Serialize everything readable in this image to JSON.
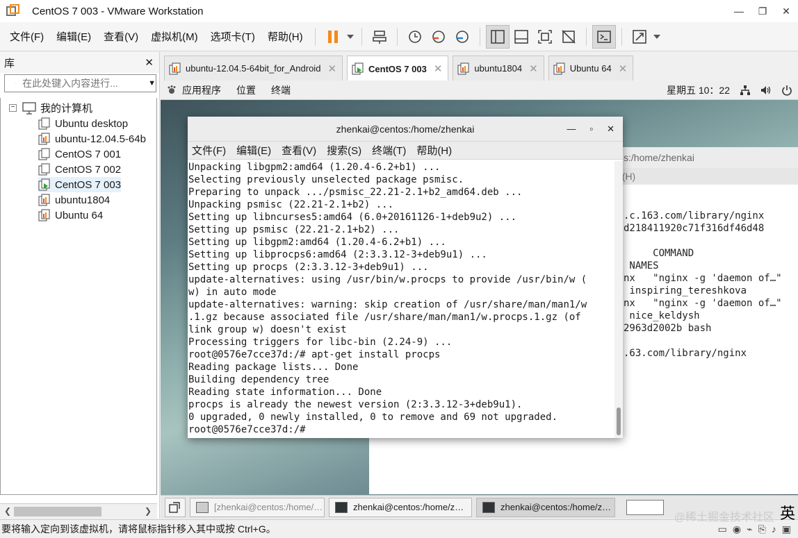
{
  "window": {
    "title": "CentOS 7 003 - VMware Workstation",
    "min": "—",
    "max": "❐",
    "close": "✕"
  },
  "menu": [
    "文件(F)",
    "编辑(E)",
    "查看(V)",
    "虚拟机(M)",
    "选项卡(T)",
    "帮助(H)"
  ],
  "library": {
    "header": "库",
    "close": "✕",
    "search_placeholder": "在此处键入内容进行...",
    "root": "我的计算机",
    "items": [
      "Ubuntu desktop",
      "ubuntu-12.04.5-64b",
      "CentOS 7 001",
      "CentOS 7 002",
      "CentOS 7 003",
      "ubuntu1804",
      "Ubuntu 64"
    ],
    "selected": "CentOS 7 003"
  },
  "tabs": [
    {
      "label": "ubuntu-12.04.5-64bit_for_Android",
      "active": false
    },
    {
      "label": "CentOS 7 003",
      "active": true
    },
    {
      "label": "ubuntu1804",
      "active": false
    },
    {
      "label": "Ubuntu 64",
      "active": false
    }
  ],
  "gnome": {
    "apps": "应用程序",
    "places": "位置",
    "terminal": "终端",
    "clock": "星期五 10：22"
  },
  "bg_terminal": {
    "title": "s:/home/zhenkai",
    "menu": "h(H)",
    "lines": [
      "",
      ".c.163.com/library/nginx",
      "d218411920c71f316df46d48",
      "",
      "     COMMAND",
      " NAMES",
      "nx   \"nginx -g 'daemon of…\"",
      " inspiring_tereshkova",
      "nx   \"nginx -g 'daemon of…\"",
      " nice_keldysh",
      "2963d2002b bash",
      "",
      ".63.com/library/nginx"
    ]
  },
  "terminal": {
    "title": "zhenkai@centos:/home/zhenkai",
    "min": "—",
    "max": "▫",
    "close": "✕",
    "menu": [
      "文件(F)",
      "编辑(E)",
      "查看(V)",
      "搜索(S)",
      "终端(T)",
      "帮助(H)"
    ],
    "lines": [
      "Unpacking libgpm2:amd64 (1.20.4-6.2+b1) ...",
      "Selecting previously unselected package psmisc.",
      "Preparing to unpack .../psmisc_22.21-2.1+b2_amd64.deb ...",
      "Unpacking psmisc (22.21-2.1+b2) ...",
      "Setting up libncurses5:amd64 (6.0+20161126-1+deb9u2) ...",
      "Setting up psmisc (22.21-2.1+b2) ...",
      "Setting up libgpm2:amd64 (1.20.4-6.2+b1) ...",
      "Setting up libprocps6:amd64 (2:3.3.12-3+deb9u1) ...",
      "Setting up procps (2:3.3.12-3+deb9u1) ...",
      "update-alternatives: using /usr/bin/w.procps to provide /usr/bin/w (",
      "w) in auto mode",
      "update-alternatives: warning: skip creation of /usr/share/man/man1/w",
      ".1.gz because associated file /usr/share/man/man1/w.procps.1.gz (of",
      "link group w) doesn't exist",
      "Processing triggers for libc-bin (2.24-9) ...",
      "root@0576e7cce37d:/# apt-get install procps",
      "Reading package lists... Done",
      "Building dependency tree",
      "Reading state information... Done",
      "procps is already the newest version (2:3.3.12-3+deb9u1).",
      "0 upgraded, 0 newly installed, 0 to remove and 69 not upgraded.",
      "root@0576e7cce37d:/#"
    ]
  },
  "taskbar": [
    {
      "label": "[zhenkai@centos:/home/…",
      "state": "dim"
    },
    {
      "label": "zhenkai@centos:/home/z…",
      "state": "normal"
    },
    {
      "label": "zhenkai@centos:/home/z…",
      "state": "active"
    }
  ],
  "status": {
    "message": "要将输入定向到该虚拟机，请将鼠标指针移入其中或按 Ctrl+G。",
    "watermark": "@稀土掘金技术社区",
    "ime": "英"
  }
}
